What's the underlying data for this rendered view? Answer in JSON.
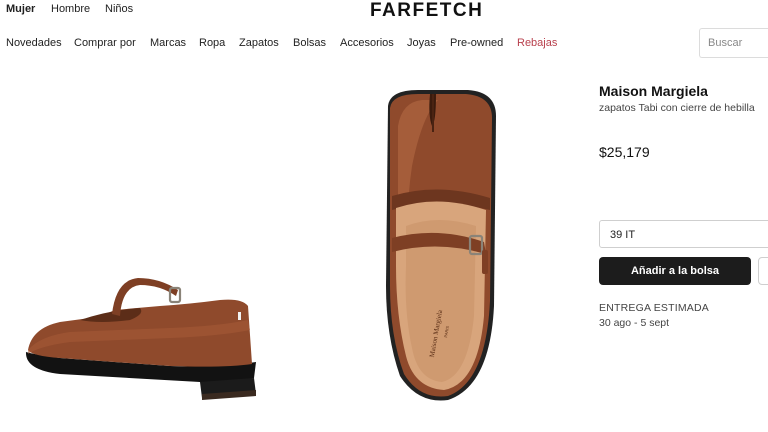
{
  "header": {
    "gender_tabs": [
      {
        "label": "Mujer",
        "active": true
      },
      {
        "label": "Hombre",
        "active": false
      },
      {
        "label": "Niños",
        "active": false
      }
    ],
    "logo": "FARFETCH",
    "search_placeholder": "Buscar"
  },
  "nav": {
    "items": [
      "Novedades",
      "Comprar por",
      "Marcas",
      "Ropa",
      "Zapatos",
      "Bolsas",
      "Accesorios",
      "Joyas",
      "Pre-owned",
      "Rebajas"
    ],
    "sale_color": "#b8404d"
  },
  "product": {
    "brand": "Maison Margiela",
    "description": "zapatos Tabi con cierre de hebilla",
    "price": "$25,179",
    "size_selected": "39 IT",
    "add_to_bag_label": "Añadir a la bolsa",
    "delivery_label": "ENTREGA ESTIMADA",
    "delivery_dates": "30 ago - 5 sept",
    "insole_logo": "Maison Margiela",
    "insole_sub": "PARIS",
    "shoe_color": "#8f4a2c"
  }
}
